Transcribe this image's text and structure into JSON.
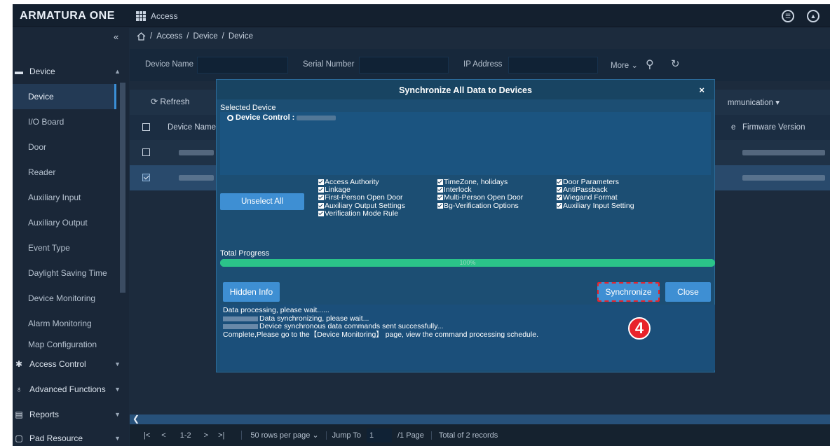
{
  "app": {
    "logo": "ARMATURA ONE",
    "module_title": "Access"
  },
  "sidebar": {
    "collapse_symbol": "«",
    "group_device": "Device",
    "sub_items": [
      "Device",
      "I/O Board",
      "Door",
      "Reader",
      "Auxiliary Input",
      "Auxiliary Output",
      "Event Type",
      "Daylight Saving Time",
      "Device Monitoring",
      "Alarm Monitoring",
      "Map Configuration"
    ],
    "groups": [
      "Access Control",
      "Advanced Functions",
      "Reports",
      "Pad Resource"
    ]
  },
  "breadcrumb": [
    "Access",
    "Device",
    "Device"
  ],
  "filter": {
    "device_name": "Device Name",
    "serial_number": "Serial Number",
    "ip_address": "IP Address",
    "more": "More"
  },
  "toolbar": {
    "refresh": "Refresh",
    "communication": "mmunication"
  },
  "table": {
    "headers": {
      "device_name": "Device Name",
      "col_e": "e",
      "firmware": "Firmware Version"
    }
  },
  "pager": {
    "first": "|<",
    "prev": "<",
    "range": "1-2",
    "next": ">",
    "last": ">|",
    "rows_per_page": "50 rows per page",
    "jump_to": "Jump To",
    "jump_value": "1",
    "pages": "/1 Page",
    "total": "Total of 2 records"
  },
  "modal": {
    "title": "Synchronize All Data to Devices",
    "close_symbol": "×",
    "selected_device_label": "Selected Device",
    "device_control_label": "Device Control :",
    "unselect_all": "Unselect All",
    "options_col1": [
      "Access Authority",
      "Linkage",
      "First-Person Open Door",
      "Auxiliary Output Settings",
      "Verification Mode Rule"
    ],
    "options_col2": [
      "TimeZone, holidays",
      "Interlock",
      "Multi-Person Open Door",
      "Bg-Verification Options"
    ],
    "options_col3": [
      "Door Parameters",
      "AntiPassback",
      "Wiegand Format",
      "Auxiliary Input Setting"
    ],
    "total_progress_label": "Total Progress",
    "progress": 1.0,
    "progress_text": "100%",
    "hidden_info": "Hidden Info",
    "synchronize": "Synchronize",
    "close": "Close",
    "log": {
      "line1": "Data processing, please wait......",
      "line2": "Data synchronizing, please wait...",
      "line3": "Device synchronous data commands sent successfully...",
      "line4": "Complete,Please go to the【Device Monitoring】 page, view the command processing schedule."
    }
  },
  "annotation": {
    "step": "4"
  },
  "colors": {
    "accent": "#3e8fd3",
    "progress": "#2bc389",
    "highlight": "#e8232b"
  }
}
